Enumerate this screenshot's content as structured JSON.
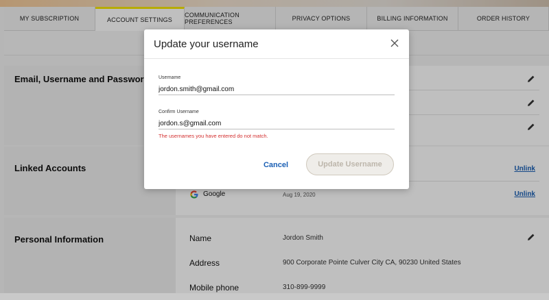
{
  "tabs": [
    {
      "label": "MY SUBSCRIPTION",
      "active": false
    },
    {
      "label": "ACCOUNT SETTINGS",
      "active": true
    },
    {
      "label": "COMMUNICATION PREFERENCES",
      "active": false
    },
    {
      "label": "PRIVACY OPTIONS",
      "active": false
    },
    {
      "label": "BILLING INFORMATION",
      "active": false
    },
    {
      "label": "ORDER HISTORY",
      "active": false
    }
  ],
  "sections": {
    "email": {
      "title": "Email, Username and Password"
    },
    "linked": {
      "title": "Linked Accounts",
      "unlink_label": "Unlink",
      "google": {
        "name": "Google",
        "date": "Aug 19, 2020"
      }
    },
    "personal": {
      "title": "Personal Information",
      "rows": [
        {
          "label": "Name",
          "value": "Jordon Smith"
        },
        {
          "label": "Address",
          "value": "900 Corporate Pointe Culver City CA, 90230 United States"
        },
        {
          "label": "Mobile phone",
          "value": "310-899-9999"
        }
      ]
    }
  },
  "icons": {
    "edit": "pencil-icon",
    "close": "close-icon",
    "google": "google-logo-icon"
  },
  "colors": {
    "accent": "#f5e400",
    "link": "#1a5fb4",
    "error": "#d32f2f"
  },
  "modal": {
    "title": "Update your username",
    "username_label": "Username",
    "username_value": "jordon.smith@gmail.com",
    "confirm_label": "Confirm Username",
    "confirm_value": "jordon.s@gmail.com",
    "error": "The usernames you have entered do not match.",
    "cancel_label": "Cancel",
    "update_label": "Update Username"
  }
}
